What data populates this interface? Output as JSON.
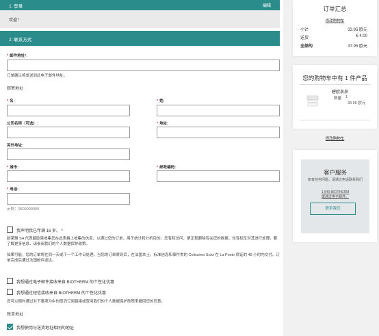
{
  "steps": {
    "login": {
      "title": "1. 登录",
      "edit_label": "编辑",
      "welcome": "欢迎！"
    },
    "contact": {
      "title": "2. 联系方式"
    }
  },
  "form": {
    "required_mark": "*",
    "email": {
      "label": "邮件地址*:",
      "value": "",
      "help": "订单确认将发送到此电子邮件地址。"
    },
    "mailing_address_heading": "邮寄地址",
    "first_name": {
      "label": "名:",
      "value": ""
    },
    "last_name": {
      "label": "姓:",
      "value": ""
    },
    "company": {
      "label": "公司名称（可选）:",
      "value": ""
    },
    "address": {
      "label": "地址:",
      "value": ""
    },
    "address2": {
      "label": "另外地址:",
      "value": ""
    },
    "city": {
      "label": "城市:",
      "value": ""
    },
    "postcode": {
      "label": "邮政编码:",
      "value": ""
    },
    "phone": {
      "label": "电话:",
      "value": "",
      "example": "示例：0600000000"
    },
    "age_check": {
      "label": "我声明我已年满 16 岁。 *",
      "checked": false
    },
    "privacy_text_1": "欧莱雅 SA 代表碧欧泉收集您在此表格上收集的信息，以通过您的订单，用于统计和分析目的。您有权访问、更正和删除有关您的数据，也有权反对其进行处理。要了解更多信息，请参阅我们的个人数据保护政策。",
    "shipping_text": "如果可能，您的订单将在同一天或下一个工作日处理。当您的订单寄到后，在法国本土，标准信息和事件类的 Colissimo Suivi 在 La Poste 保证的 48 小时内交付。订单完成后通过法国邮件送达。",
    "email_optin": {
      "label": "我想通过电子邮件接收来自 BIOTHERM 的个性化优惠",
      "checked": false
    },
    "sms_optin": {
      "label": "我想通过短信接收来自 BIOTHERM 的个性化优惠",
      "checked": false
    },
    "privacy_text_2": "您可以随时通过对下事项为中的取消订阅链接或查阅我们的个人数据保护政策来撤回您的同意。",
    "billing_heading": "账单地址",
    "same_address": {
      "label": "我想使用与送货地址相同的地址",
      "checked": true
    }
  },
  "summary": {
    "title": "订单汇总",
    "edit_cart": "修改购物车",
    "subtotal_label": "小计",
    "subtotal_value": "33.95 欧元",
    "shipping_label": "送货",
    "shipping_value": "€ 4.00",
    "total_label": "全部的",
    "total_value": "37.95 欧元"
  },
  "cart": {
    "title": "您的购物车中有 1 件产品",
    "product_name": "碧欧泉泉",
    "qty_label": "数量",
    "qty_value": "1",
    "price": "33.95 欧元",
    "edit_cart": "修改购物车"
  },
  "service": {
    "title": "客户服务",
    "text": "如有任何问题，请通过电话联系我们",
    "phone": "1-849 BIOTHERM",
    "email_link": "或通过电子邮件。",
    "button": "联系我们"
  },
  "colors": {
    "accent": "#2b8c8c",
    "required": "#c0392b"
  }
}
